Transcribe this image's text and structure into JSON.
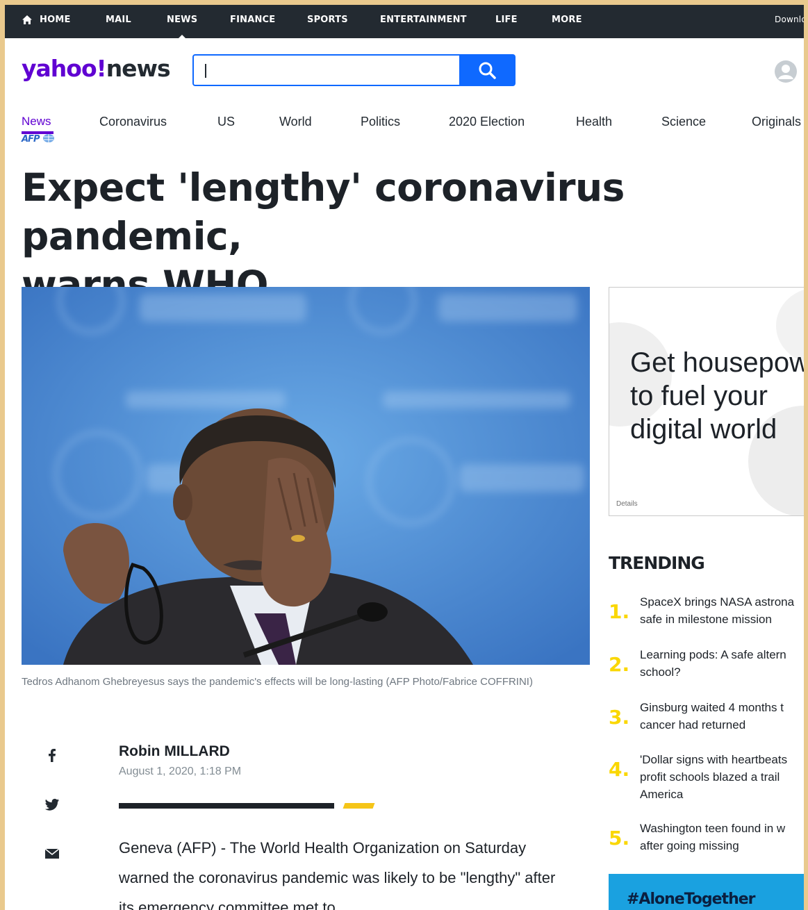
{
  "topnav": {
    "items": [
      "HOME",
      "MAIL",
      "NEWS",
      "FINANCE",
      "SPORTS",
      "ENTERTAINMENT",
      "LIFE",
      "MORE"
    ],
    "right_text": "Downlo"
  },
  "header": {
    "logo_main": "yahoo",
    "logo_bang": "!",
    "logo_news": "news",
    "search_value": "",
    "search_icon": "search-icon",
    "avatar_icon": "user-avatar-icon"
  },
  "subnav": {
    "items": [
      "News",
      "Coronavirus",
      "US",
      "World",
      "Politics",
      "2020 Election",
      "Health",
      "Science",
      "Originals"
    ],
    "active": "News",
    "partner": "AFP"
  },
  "article": {
    "headline": "Expect 'lengthy' coronavirus pandemic,\nwarns WHO",
    "caption": "Tedros Adhanom Ghebreyesus says the pandemic's effects will be long-lasting (AFP Photo/Fabrice COFFRINI)",
    "author": "Robin MILLARD",
    "date": "August 1, 2020, 1:18 PM",
    "body": "Geneva (AFP) - The World Health Organization on Saturday warned the coronavirus pandemic was likely to be \"lengthy\" after its emergency committee met to",
    "share_icons": [
      "facebook-icon",
      "twitter-icon",
      "email-icon"
    ]
  },
  "ad": {
    "text": "Get housepow\nto fuel your\ndigital world",
    "details": "Details"
  },
  "trending": {
    "title": "TRENDING",
    "items": [
      {
        "num": "1.",
        "text": "SpaceX brings NASA astrona\nsafe in milestone mission"
      },
      {
        "num": "2.",
        "text": "Learning pods: A safe altern\nschool?"
      },
      {
        "num": "3.",
        "text": "Ginsburg waited 4 months t\ncancer had returned"
      },
      {
        "num": "4.",
        "text": "'Dollar signs with heartbeats\nprofit schools blazed a trail\nAmerica"
      },
      {
        "num": "5.",
        "text": "Washington teen found in w\nafter going missing"
      }
    ]
  },
  "promo": {
    "text": "#AloneTogether"
  },
  "colors": {
    "brand": "#6001d2",
    "topnav_bg": "#232a31",
    "search_blue": "#0f69ff",
    "trending_yellow": "#fad702"
  }
}
